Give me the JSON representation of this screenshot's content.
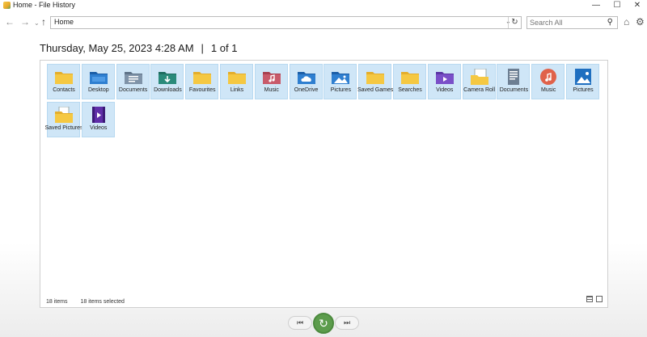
{
  "window": {
    "title": "Home - File History",
    "minimize": "—",
    "maximize": "☐",
    "close": "✕"
  },
  "nav": {
    "back": "←",
    "forward": "→",
    "recent": "⌄",
    "up": "↑",
    "refresh": "↻",
    "dropdown": "⌄"
  },
  "address": {
    "value": "Home"
  },
  "search": {
    "placeholder": "Search All",
    "icon": "⚲"
  },
  "toolbar": {
    "home": "⌂",
    "settings": "⚙"
  },
  "header": {
    "date": "Thursday, May 25, 2023 4:28 AM",
    "separator": "|",
    "page": "1 of 1"
  },
  "items": [
    {
      "label": "Contacts",
      "icon": "folder"
    },
    {
      "label": "Desktop",
      "icon": "folder-desktop"
    },
    {
      "label": "Documents",
      "icon": "folder-documents"
    },
    {
      "label": "Downloads",
      "icon": "folder-downloads"
    },
    {
      "label": "Favourites",
      "icon": "folder"
    },
    {
      "label": "Links",
      "icon": "folder"
    },
    {
      "label": "Music",
      "icon": "folder-music"
    },
    {
      "label": "OneDrive",
      "icon": "folder-onedrive"
    },
    {
      "label": "Pictures",
      "icon": "folder-pictures"
    },
    {
      "label": "Saved Games",
      "icon": "folder"
    },
    {
      "label": "Searches",
      "icon": "folder"
    },
    {
      "label": "Videos",
      "icon": "folder-videos"
    },
    {
      "label": "Camera Roll",
      "icon": "camera-roll"
    },
    {
      "label": "Documents",
      "icon": "library-documents"
    },
    {
      "label": "Music",
      "icon": "library-music"
    },
    {
      "label": "Pictures",
      "icon": "library-pictures"
    },
    {
      "label": "Saved Pictures",
      "icon": "folder-saved-pictures"
    },
    {
      "label": "Videos",
      "icon": "library-videos"
    }
  ],
  "status": {
    "count": "18 items",
    "selected": "18 items selected"
  },
  "playback": {
    "previous": "⏮",
    "restore": "↻",
    "next": "⏭"
  },
  "colors": {
    "selection": "#cfe6f7",
    "selection_border": "#b8d9f1",
    "restore_green": "#5c9c4c",
    "folder_yellow": "#f5c842"
  }
}
